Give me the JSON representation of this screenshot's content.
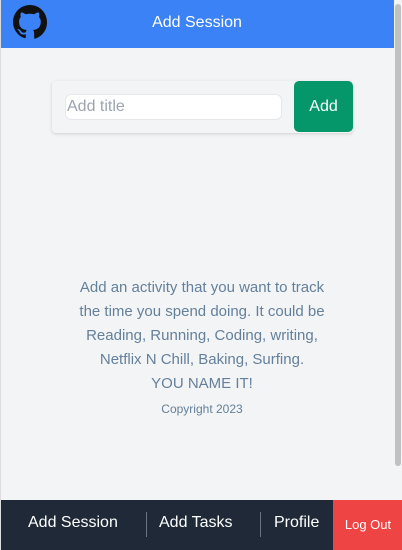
{
  "header": {
    "title": "Add Session",
    "logo_icon": "github-icon"
  },
  "form": {
    "placeholder": "Add title",
    "value": "",
    "add_label": "Add"
  },
  "description": [
    "Add an activity that you want to track",
    "the time you spend doing. It could be",
    "Reading, Running, Coding, writing,",
    "Netflix N Chill, Baking, Surfing.",
    "YOU NAME IT!"
  ],
  "copyright": "Copyright 2023",
  "nav": {
    "items": [
      "Add Session",
      "Add Tasks",
      "Profile"
    ],
    "logout": "Log Out"
  },
  "colors": {
    "header": "#3b82f6",
    "add": "#059669",
    "nav": "#1f2937",
    "logout": "#ef4444"
  }
}
